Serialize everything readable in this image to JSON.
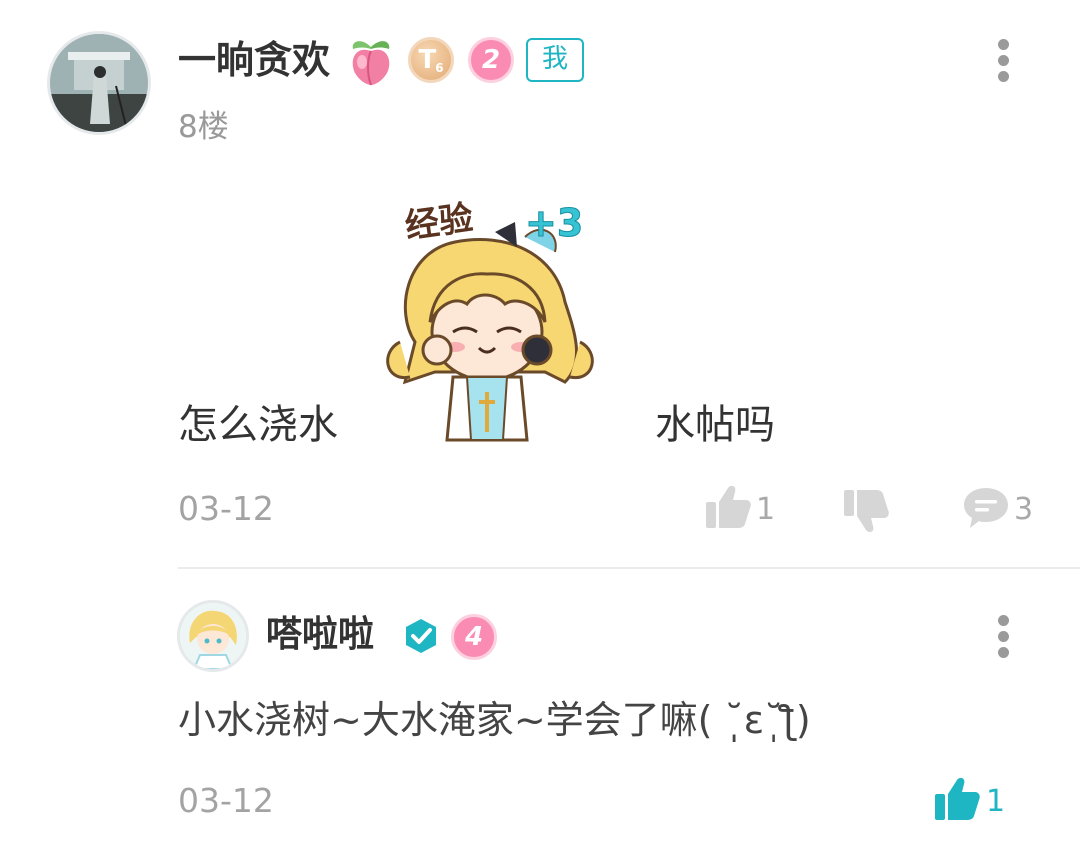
{
  "post": {
    "username": "一晌贪欢",
    "title_badge_letter": "T",
    "title_badge_level": "6",
    "level": "2",
    "self_tag": "我",
    "floor": "8楼",
    "content_before_sticker": "怎么浇水",
    "sticker_text": "经验+3",
    "content_after_sticker": "水帖吗",
    "date": "03-12",
    "like_count": "1",
    "comment_count": "3",
    "icons": [
      "avatar",
      "peach-icon",
      "title-badge-icon",
      "more-icon",
      "thumbs-up-icon",
      "thumbs-down-icon",
      "comment-icon"
    ]
  },
  "reply": {
    "username": "嗒啦啦",
    "level": "4",
    "content": "小水浇树~大水淹家~学会了嘛( ˘̩̩̩ε˘̩ƪ)",
    "date": "03-12",
    "like_count": "1",
    "icons": [
      "avatar",
      "verified-icon",
      "more-icon",
      "thumbs-up-icon"
    ]
  },
  "colors": {
    "accent": "#1fb6c3",
    "level_badge": "#fa8bb2",
    "muted_text": "#a3a3a3",
    "icon_gray": "#d3d3d3"
  }
}
